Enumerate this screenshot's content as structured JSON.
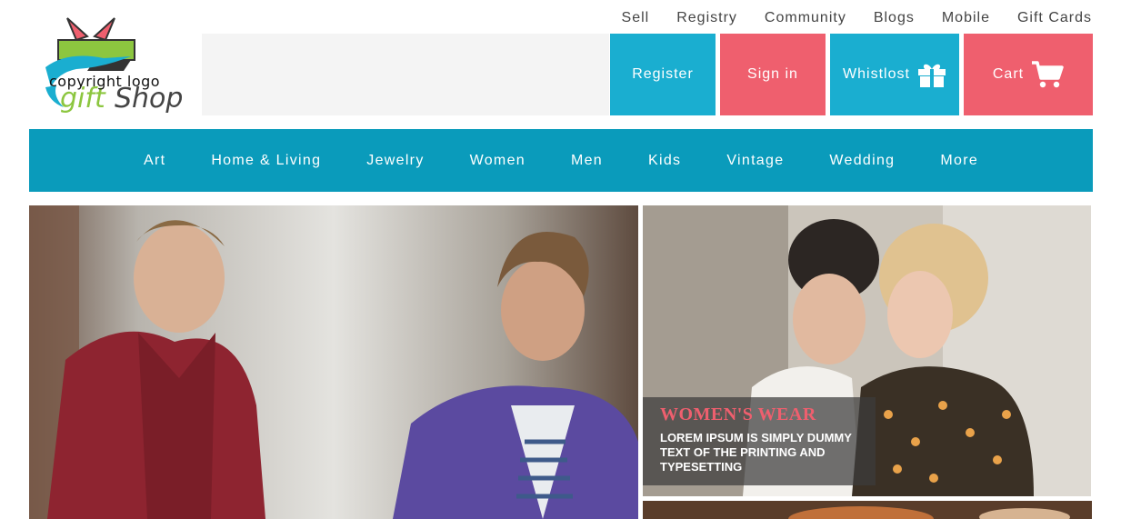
{
  "top_links": [
    "Sell",
    "Registry",
    "Community",
    "Blogs",
    "Mobile",
    "Gift Cards"
  ],
  "logo": {
    "caption": "copyright logo",
    "brand_text": "gift Shop"
  },
  "search": {
    "placeholder": ""
  },
  "actions": {
    "register": "Register",
    "sign_in": "Sign in",
    "wishlist": "Whistlost",
    "cart": "Cart"
  },
  "nav": [
    "Art",
    "Home & Living",
    "Jewelry",
    "Women",
    "Men",
    "Kids",
    "Vintage",
    "Wedding",
    "More"
  ],
  "promo": {
    "title": "WOMEN'S WEAR",
    "text": "LOREM IPSUM IS SIMPLY DUMMY TEXT OF THE PRINTING AND TYPESETTING"
  },
  "colors": {
    "teal": "#1aaed0",
    "nav_teal": "#0a9bbb",
    "coral": "#ef5f6e"
  }
}
